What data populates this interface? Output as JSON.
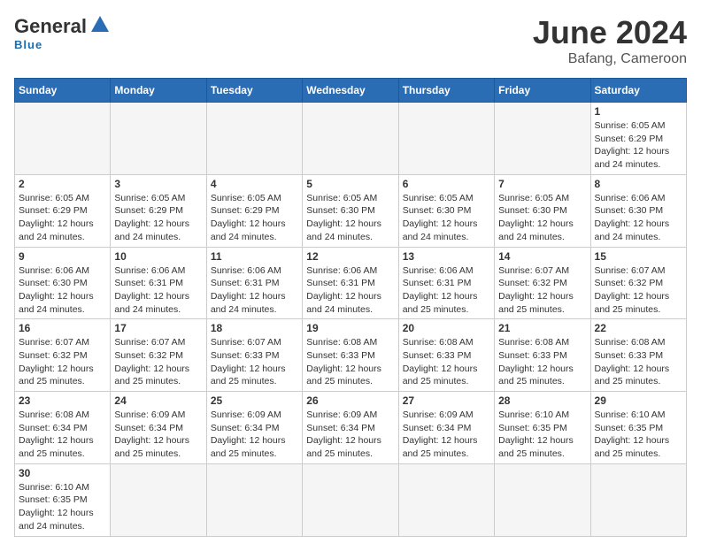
{
  "header": {
    "logo_general": "General",
    "logo_blue": "Blue",
    "month_title": "June 2024",
    "location": "Bafang, Cameroon"
  },
  "days_of_week": [
    "Sunday",
    "Monday",
    "Tuesday",
    "Wednesday",
    "Thursday",
    "Friday",
    "Saturday"
  ],
  "weeks": [
    [
      {
        "day": null,
        "info": null
      },
      {
        "day": null,
        "info": null
      },
      {
        "day": null,
        "info": null
      },
      {
        "day": null,
        "info": null
      },
      {
        "day": null,
        "info": null
      },
      {
        "day": null,
        "info": null
      },
      {
        "day": "1",
        "info": "Sunrise: 6:05 AM\nSunset: 6:29 PM\nDaylight: 12 hours\nand 24 minutes."
      }
    ],
    [
      {
        "day": "2",
        "info": "Sunrise: 6:05 AM\nSunset: 6:29 PM\nDaylight: 12 hours\nand 24 minutes."
      },
      {
        "day": "3",
        "info": "Sunrise: 6:05 AM\nSunset: 6:29 PM\nDaylight: 12 hours\nand 24 minutes."
      },
      {
        "day": "4",
        "info": "Sunrise: 6:05 AM\nSunset: 6:29 PM\nDaylight: 12 hours\nand 24 minutes."
      },
      {
        "day": "5",
        "info": "Sunrise: 6:05 AM\nSunset: 6:30 PM\nDaylight: 12 hours\nand 24 minutes."
      },
      {
        "day": "6",
        "info": "Sunrise: 6:05 AM\nSunset: 6:30 PM\nDaylight: 12 hours\nand 24 minutes."
      },
      {
        "day": "7",
        "info": "Sunrise: 6:05 AM\nSunset: 6:30 PM\nDaylight: 12 hours\nand 24 minutes."
      },
      {
        "day": "8",
        "info": "Sunrise: 6:06 AM\nSunset: 6:30 PM\nDaylight: 12 hours\nand 24 minutes."
      }
    ],
    [
      {
        "day": "9",
        "info": "Sunrise: 6:06 AM\nSunset: 6:30 PM\nDaylight: 12 hours\nand 24 minutes."
      },
      {
        "day": "10",
        "info": "Sunrise: 6:06 AM\nSunset: 6:31 PM\nDaylight: 12 hours\nand 24 minutes."
      },
      {
        "day": "11",
        "info": "Sunrise: 6:06 AM\nSunset: 6:31 PM\nDaylight: 12 hours\nand 24 minutes."
      },
      {
        "day": "12",
        "info": "Sunrise: 6:06 AM\nSunset: 6:31 PM\nDaylight: 12 hours\nand 24 minutes."
      },
      {
        "day": "13",
        "info": "Sunrise: 6:06 AM\nSunset: 6:31 PM\nDaylight: 12 hours\nand 25 minutes."
      },
      {
        "day": "14",
        "info": "Sunrise: 6:07 AM\nSunset: 6:32 PM\nDaylight: 12 hours\nand 25 minutes."
      },
      {
        "day": "15",
        "info": "Sunrise: 6:07 AM\nSunset: 6:32 PM\nDaylight: 12 hours\nand 25 minutes."
      }
    ],
    [
      {
        "day": "16",
        "info": "Sunrise: 6:07 AM\nSunset: 6:32 PM\nDaylight: 12 hours\nand 25 minutes."
      },
      {
        "day": "17",
        "info": "Sunrise: 6:07 AM\nSunset: 6:32 PM\nDaylight: 12 hours\nand 25 minutes."
      },
      {
        "day": "18",
        "info": "Sunrise: 6:07 AM\nSunset: 6:33 PM\nDaylight: 12 hours\nand 25 minutes."
      },
      {
        "day": "19",
        "info": "Sunrise: 6:08 AM\nSunset: 6:33 PM\nDaylight: 12 hours\nand 25 minutes."
      },
      {
        "day": "20",
        "info": "Sunrise: 6:08 AM\nSunset: 6:33 PM\nDaylight: 12 hours\nand 25 minutes."
      },
      {
        "day": "21",
        "info": "Sunrise: 6:08 AM\nSunset: 6:33 PM\nDaylight: 12 hours\nand 25 minutes."
      },
      {
        "day": "22",
        "info": "Sunrise: 6:08 AM\nSunset: 6:33 PM\nDaylight: 12 hours\nand 25 minutes."
      }
    ],
    [
      {
        "day": "23",
        "info": "Sunrise: 6:08 AM\nSunset: 6:34 PM\nDaylight: 12 hours\nand 25 minutes."
      },
      {
        "day": "24",
        "info": "Sunrise: 6:09 AM\nSunset: 6:34 PM\nDaylight: 12 hours\nand 25 minutes."
      },
      {
        "day": "25",
        "info": "Sunrise: 6:09 AM\nSunset: 6:34 PM\nDaylight: 12 hours\nand 25 minutes."
      },
      {
        "day": "26",
        "info": "Sunrise: 6:09 AM\nSunset: 6:34 PM\nDaylight: 12 hours\nand 25 minutes."
      },
      {
        "day": "27",
        "info": "Sunrise: 6:09 AM\nSunset: 6:34 PM\nDaylight: 12 hours\nand 25 minutes."
      },
      {
        "day": "28",
        "info": "Sunrise: 6:10 AM\nSunset: 6:35 PM\nDaylight: 12 hours\nand 25 minutes."
      },
      {
        "day": "29",
        "info": "Sunrise: 6:10 AM\nSunset: 6:35 PM\nDaylight: 12 hours\nand 25 minutes."
      }
    ],
    [
      {
        "day": "30",
        "info": "Sunrise: 6:10 AM\nSunset: 6:35 PM\nDaylight: 12 hours\nand 24 minutes."
      },
      {
        "day": null,
        "info": null
      },
      {
        "day": null,
        "info": null
      },
      {
        "day": null,
        "info": null
      },
      {
        "day": null,
        "info": null
      },
      {
        "day": null,
        "info": null
      },
      {
        "day": null,
        "info": null
      }
    ]
  ]
}
